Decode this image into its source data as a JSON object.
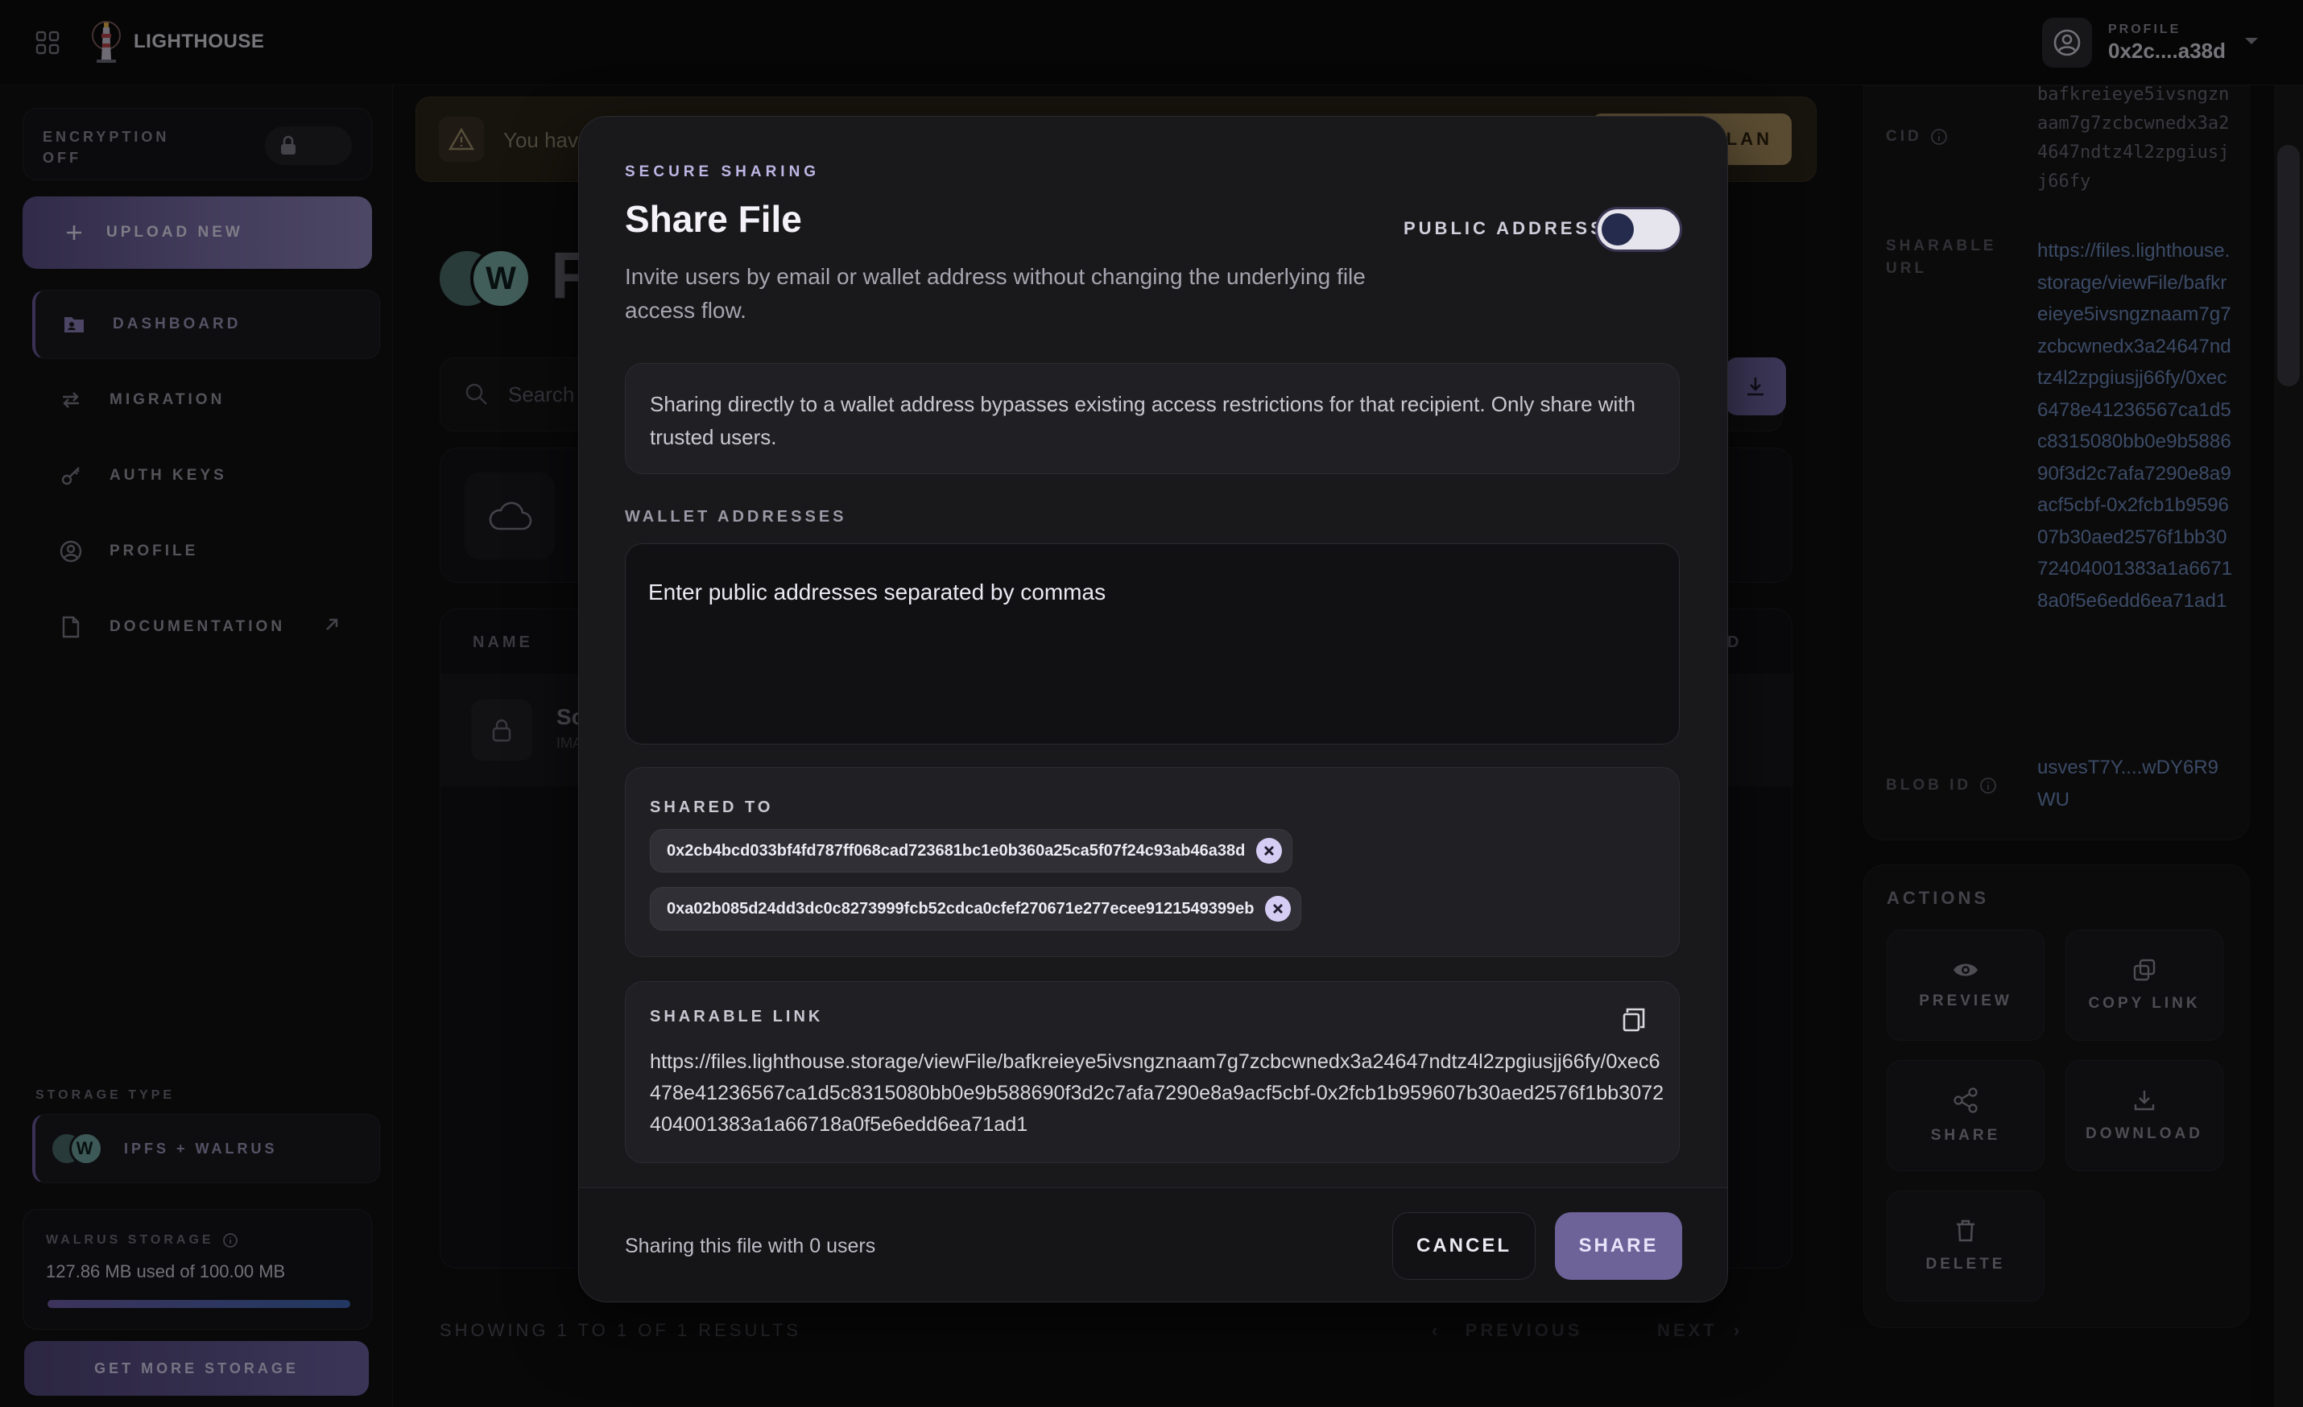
{
  "topbar": {
    "brand": "LIGHTHOUSE",
    "profile_caption": "PROFILE",
    "profile_address": "0x2c....a38d"
  },
  "sidebar": {
    "encryption_label": "ENCRYPTION OFF",
    "upload_label": "UPLOAD NEW",
    "items": [
      {
        "label": "DASHBOARD",
        "icon": "folder-user-icon",
        "active": true
      },
      {
        "label": "MIGRATION",
        "icon": "swap-arrows-icon",
        "active": false
      },
      {
        "label": "AUTH KEYS",
        "icon": "key-icon",
        "active": false
      },
      {
        "label": "PROFILE",
        "icon": "user-circle-icon",
        "active": false
      },
      {
        "label": "DOCUMENTATION",
        "icon": "document-icon",
        "active": false
      }
    ],
    "storage_type_caption": "STORAGE TYPE",
    "storage_type_value": "IPFS + WALRUS",
    "walrus_caption": "WALRUS STORAGE",
    "walrus_used": "127.86 MB used of 100.00 MB",
    "get_more_label": "GET MORE STORAGE"
  },
  "main": {
    "banner_text": "You hav",
    "banner_button": "LAN",
    "page_title": "F",
    "search_placeholder": "Search",
    "table_header_name": "NAME",
    "table_header_d": "D",
    "row_name": "Sc",
    "row_sub": "IMA",
    "pagination_text": "SHOWING 1 TO 1 OF 1 RESULTS",
    "prev_label": "PREVIOUS",
    "next_label": "NEXT"
  },
  "details": {
    "cid_label": "CID",
    "cid_value": "bafkreieye5ivsngznaam7g7zcbcwnedx3a24647ndtz4l2zpgiusjj66fy",
    "url_label": "SHARABLE URL",
    "url_value": "https://files.lighthouse.storage/viewFile/bafkreieye5ivsngznaam7g7zcbcwnedx3a24647ndtz4l2zpgiusjj66fy/0xec6478e41236567ca1d5c8315080bb0e9b588690f3d2c7afa7290e8a9acf5cbf-0x2fcb1b959607b30aed2576f1bb3072404001383a1a66718a0f5e6edd6ea71ad1",
    "blob_label": "BLOB ID",
    "blob_value": "usvesT7Y....wDY6R9WU",
    "actions_caption": "ACTIONS",
    "actions": {
      "preview": "PREVIEW",
      "copy_link": "COPY LINK",
      "share": "SHARE",
      "download": "DOWNLOAD",
      "delete": "DELETE"
    }
  },
  "modal": {
    "eyebrow": "SECURE SHARING",
    "title": "Share File",
    "description": "Invite users by email or wallet address without changing the underlying file access flow.",
    "public_address_label": "PUBLIC ADDRESS",
    "public_address_on": false,
    "warning": "Sharing directly to a wallet address bypasses existing access restrictions for that recipient. Only share with trusted users.",
    "wallet_caption": "WALLET ADDRESSES",
    "wallet_placeholder": "Enter public addresses separated by commas",
    "shared_caption": "SHARED TO",
    "shared_to": [
      "0x2cb4bcd033bf4fd787ff068cad723681bc1e0b360a25ca5f07f24c93ab46a38d",
      "0xa02b085d24dd3dc0c8273999fcb52cdca0cfef270671e277ecee9121549399eb"
    ],
    "link_caption": "SHARABLE LINK",
    "link_value": "https://files.lighthouse.storage/viewFile/bafkreieye5ivsngznaam7g7zcbcwnedx3a24647ndtz4l2zpgiusjj66fy/0xec6478e41236567ca1d5c8315080bb0e9b588690f3d2c7afa7290e8a9acf5cbf-0x2fcb1b959607b30aed2576f1bb3072404001383a1a66718a0f5e6edd6ea71ad1",
    "footer_text": "Sharing this file with 0 users",
    "cancel_label": "CANCEL",
    "share_label": "SHARE"
  },
  "colors": {
    "accent": "#6d6399",
    "link": "#6c87b8",
    "warning_banner": "#a48a5c"
  }
}
